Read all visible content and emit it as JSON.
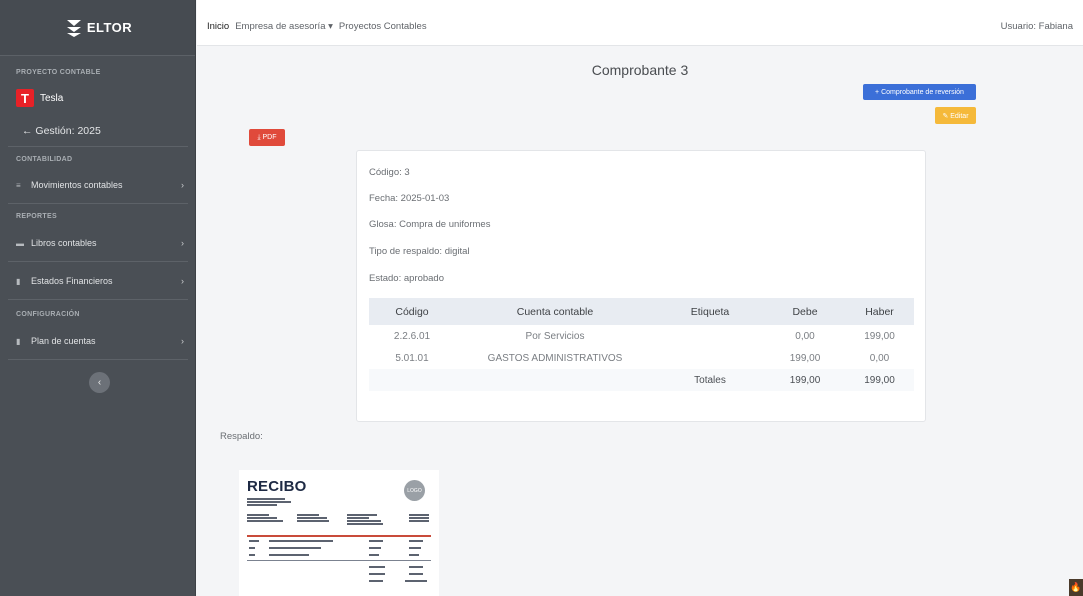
{
  "brand": {
    "name": "ELTOR"
  },
  "sidebar": {
    "project_section": "PROYECTO CONTABLE",
    "project_name": "Tesla",
    "project_logo_letter": "T",
    "gestion": "← Gestión: 2025",
    "accounting_section": "CONTABILIDAD",
    "accounting_items": [
      {
        "label": "Movimientos contables",
        "icon": "list-icon"
      }
    ],
    "reports_section": "REPORTES",
    "reports_items": [
      {
        "label": "Libros contables",
        "icon": "book-icon"
      },
      {
        "label": "Estados Financieros",
        "icon": "file-icon"
      }
    ],
    "config_section": "CONFIGURACIÓN",
    "config_items": [
      {
        "label": "Plan de cuentas",
        "icon": "file-icon"
      }
    ],
    "collapse_icon": "‹"
  },
  "topbar": {
    "breadcrumb": {
      "home": "Inicio",
      "company": "Empresa de asesoría ▾",
      "projects": "Proyectos Contables"
    },
    "user": "Usuario: Fabiana"
  },
  "page": {
    "title": "Comprobante 3",
    "reversal_button": "+ Comprobante de reversión",
    "edit_button": "✎ Editar",
    "pdf_button": "⤓ PDF"
  },
  "voucher": {
    "codigo": "Código: 3",
    "fecha": "Fecha: 2025-01-03",
    "glosa": "Glosa: Compra de uniformes",
    "tipo": "Tipo de respaldo: digital",
    "estado": "Estado: aprobado",
    "headers": [
      "Código",
      "Cuenta contable",
      "Etiqueta",
      "Debe",
      "Haber"
    ],
    "rows": [
      {
        "codigo": "2.2.6.01",
        "cuenta": "Por Servicios",
        "etiqueta": "",
        "debe": "0,00",
        "haber": "199,00"
      },
      {
        "codigo": "5.01.01",
        "cuenta": "GASTOS ADMINISTRATIVOS",
        "etiqueta": "",
        "debe": "199,00",
        "haber": "0,00"
      }
    ],
    "totals": {
      "label": "Totales",
      "debe": "199,00",
      "haber": "199,00"
    }
  },
  "respaldo": {
    "label": "Respaldo:",
    "receipt_title": "RECIBO",
    "receipt_logo": "LOGO"
  },
  "colors": {
    "sidebar": "#4a4f55",
    "primary": "#3b6fd8",
    "warning": "#f5b93a",
    "danger": "#e04a3b"
  }
}
